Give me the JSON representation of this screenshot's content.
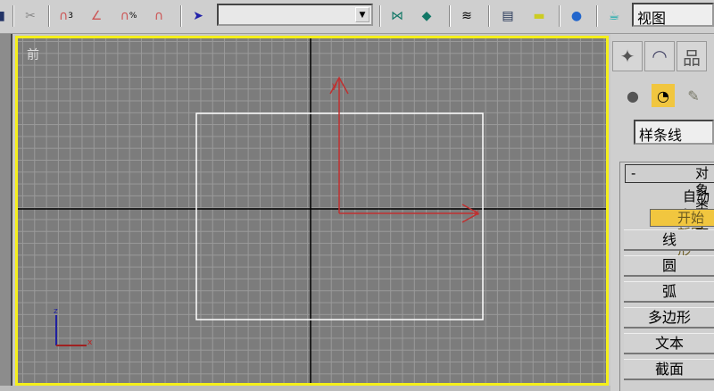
{
  "toolbar": {
    "icons": [
      "select-link-icon",
      "unlink-icon",
      "snap-3d-icon",
      "angle-snap-icon",
      "percent-snap-icon",
      "spinner-snap-icon",
      "named-selection-icon",
      "mirror-icon",
      "align-icon",
      "layers-icon",
      "curve-editor-icon",
      "schematic-icon",
      "material-editor-icon",
      "render-scene-icon"
    ],
    "named_selection_value": "",
    "render_dropdown": "视图"
  },
  "viewport": {
    "label": "前",
    "border_color": "#f4ef1a",
    "axis_labels": {
      "z": "z",
      "x": "x"
    }
  },
  "command_panel": {
    "tabs": [
      "create-tab",
      "modify-tab",
      "hierarchy-tab"
    ],
    "subcategories": [
      "geometry",
      "shapes",
      "lights"
    ],
    "category_dropdown": "样条线",
    "rollout": {
      "title": "对象类型",
      "collapse_symbol": "-",
      "auto_grid": "自动栅格",
      "start_new_shape": "开始新图形",
      "buttons": [
        "线",
        "圆",
        "弧",
        "多边形",
        "文本",
        "截面"
      ]
    }
  }
}
